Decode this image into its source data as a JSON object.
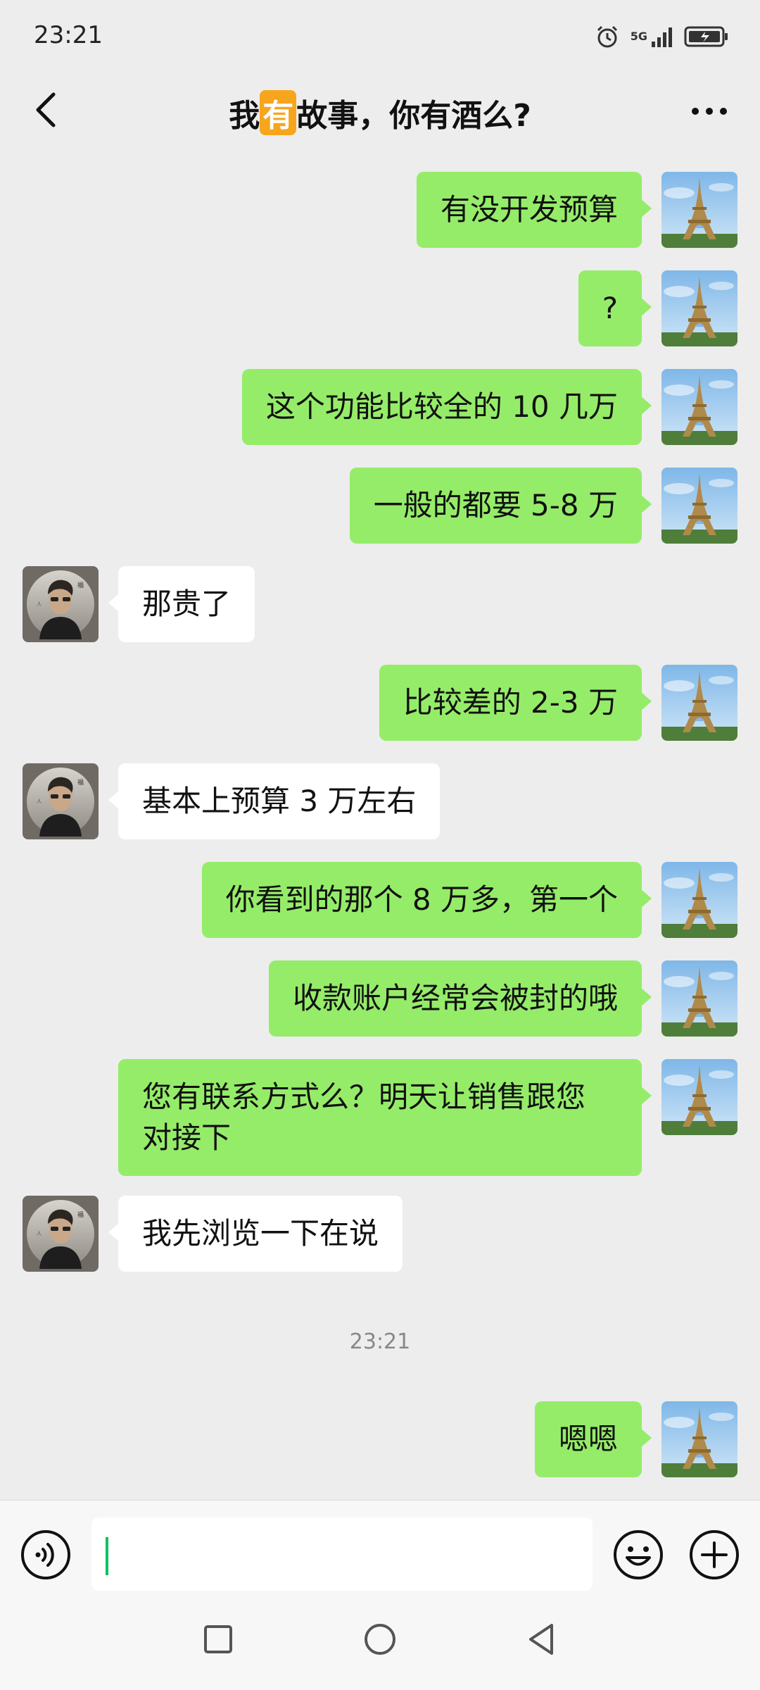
{
  "status_bar": {
    "time": "23:21",
    "network": "5G"
  },
  "header": {
    "title_prefix": "我",
    "title_highlight": "有",
    "title_suffix": "故事，你有酒么?"
  },
  "messages": [
    {
      "from": "self",
      "text": "有没开发预算"
    },
    {
      "from": "self",
      "text": "?"
    },
    {
      "from": "self",
      "text": "这个功能比较全的 10 几万"
    },
    {
      "from": "self",
      "text": "一般的都要 5-8 万"
    },
    {
      "from": "other",
      "text": "那贵了"
    },
    {
      "from": "self",
      "text": "比较差的 2-3 万"
    },
    {
      "from": "other",
      "text": "基本上预算 3 万左右"
    },
    {
      "from": "self",
      "text": "你看到的那个 8 万多，第一个"
    },
    {
      "from": "self",
      "text": "收款账户经常会被封的哦"
    },
    {
      "from": "self",
      "text": "您有联系方式么？明天让销售跟您\n对接下"
    },
    {
      "from": "other",
      "text": "我先浏览一下在说"
    },
    {
      "from": "self",
      "text": "嗯嗯"
    }
  ],
  "timestamp": "23:21",
  "colors": {
    "self_bubble": "#95ec69",
    "other_bubble": "#ffffff",
    "background": "#ededed",
    "cursor": "#07c160",
    "title_badge": "#f7a51c"
  },
  "icons": {
    "back": "chevron-left-icon",
    "more": "more-dots-icon",
    "voice": "voice-icon",
    "emoji": "emoji-icon",
    "plus": "plus-icon",
    "nav_recent": "square-icon",
    "nav_home": "circle-icon",
    "nav_back": "triangle-back-icon"
  }
}
